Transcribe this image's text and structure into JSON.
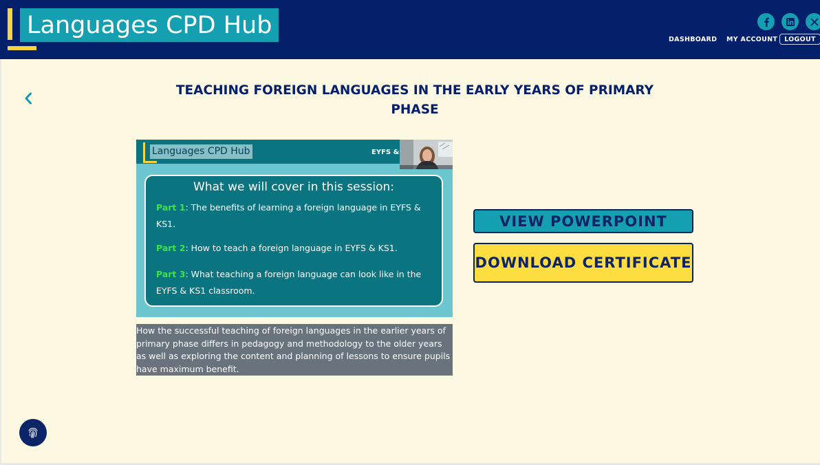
{
  "header": {
    "logo_text": "Languages CPD Hub",
    "social_icons": [
      "facebook-icon",
      "linkedin-icon",
      "x-icon"
    ],
    "nav": {
      "dashboard": "DASHBOARD",
      "my_account": "MY ACCOUNT",
      "logout": "LOGOUT"
    }
  },
  "course": {
    "title": "TEACHING FOREIGN LANGUAGES IN THE EARLY YEARS OF PRIMARY PHASE",
    "description": "How the successful teaching of foreign languages in the earlier years of primary phase differs in pedagogy and methodology to the older years as well as exploring the content and planning of lessons to ensure pupils have maximum benefit."
  },
  "slide": {
    "logo_text": "Languages CPD Hub",
    "tag": "EYFS & K",
    "heading": "What we will cover in this session:",
    "parts": [
      {
        "label": "Part 1",
        "text": ": The benefits of learning a foreign language in EYFS & KS1."
      },
      {
        "label": "Part 2",
        "text": ": How to teach a foreign language in EYFS & KS1."
      },
      {
        "label": "Part 3",
        "text": ": What teaching a foreign language can look like in the EYFS & KS1 classroom."
      }
    ]
  },
  "buttons": {
    "view_powerpoint": "VIEW POWERPOINT",
    "download_certificate": "DOWNLOAD CERTIFICATE"
  },
  "colors": {
    "header_bg": "#05206b",
    "accent_teal": "#14a0b0",
    "accent_yellow": "#fedd40",
    "page_bg": "#fdf8e1",
    "title_navy": "#05206b"
  }
}
